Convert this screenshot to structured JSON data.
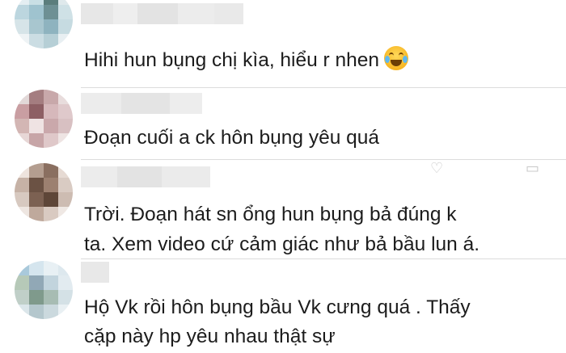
{
  "comments": [
    {
      "text": "Hihi hun bụng chị kìa, hiểu r nhen",
      "emoji": "tears-of-joy-icon"
    },
    {
      "text": "Đoạn cuối a ck hôn bụng yêu quá"
    },
    {
      "lines": [
        "Trời. Đoạn hát sn ổng hun bụng bả đúng k",
        "ta. Xem video cứ cảm giác như bả bầu lun á."
      ]
    },
    {
      "lines": [
        "Hộ Vk rồi hôn bụng bầu Vk cưng quá . Thấy",
        "cặp này hp yêu nhau thật sự"
      ]
    }
  ],
  "icons": {
    "heart": "heart-icon",
    "menu": "more-icon"
  },
  "colors": {
    "text": "#1c1c1c",
    "divider": "#dcdcdc"
  }
}
